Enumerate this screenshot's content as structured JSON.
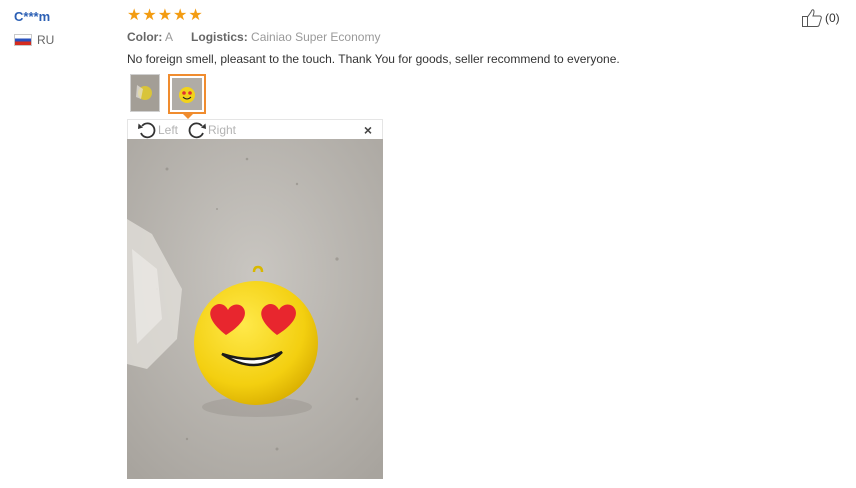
{
  "review": {
    "user": "C***m",
    "country": "RU",
    "rating": 5,
    "color_label": "Color:",
    "color_value": "A",
    "logistics_label": "Logistics:",
    "logistics_value": "Cainiao Super Economy",
    "text": "No foreign smell, pleasant to the touch. Thank You for goods, seller recommend to everyone.",
    "helpful_count": "(0)"
  },
  "viewer": {
    "rotate_left": "Left",
    "rotate_right": "Right",
    "close": "×"
  },
  "icons": {
    "star": "star-icon",
    "helpful": "thumbs-up-icon",
    "rotate_left": "rotate-left-icon",
    "rotate_right": "rotate-right-icon",
    "close": "close-icon"
  },
  "colors": {
    "username": "#2b5fb4",
    "star": "#f39c12",
    "active_thumb_border": "#f08c2e"
  }
}
